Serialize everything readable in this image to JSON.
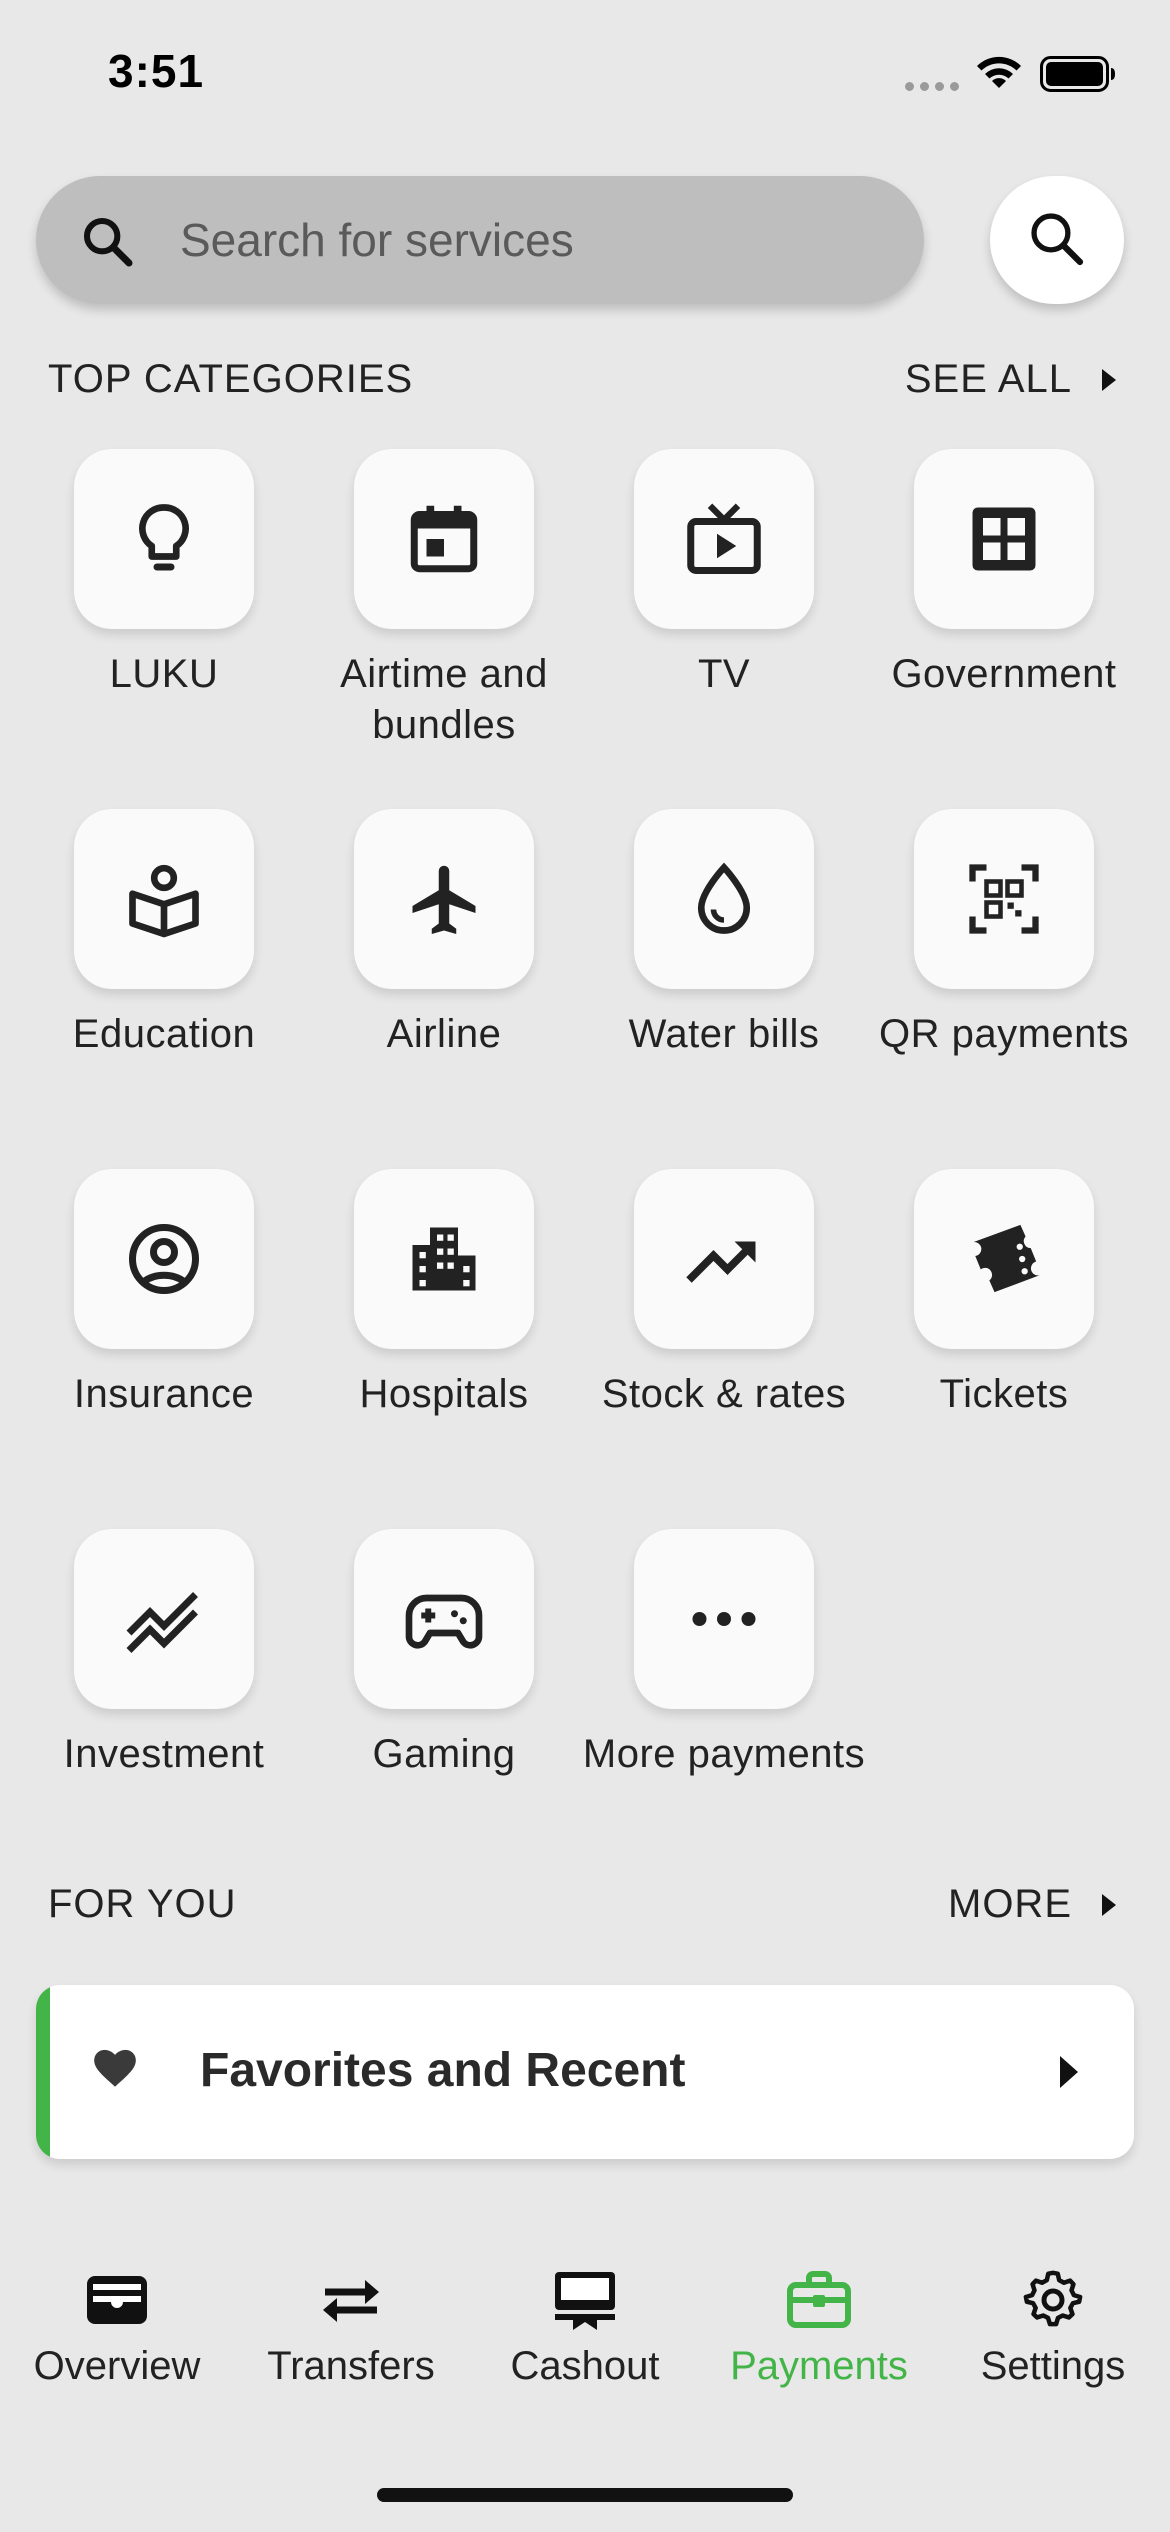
{
  "status_bar": {
    "time": "3:51"
  },
  "search": {
    "placeholder": "Search for services"
  },
  "top_categories": {
    "title": "TOP CATEGORIES",
    "link": "SEE ALL",
    "items": [
      {
        "label": "LUKU",
        "icon": "lightbulb-icon"
      },
      {
        "label": "Airtime and bundles",
        "icon": "calendar-icon"
      },
      {
        "label": "TV",
        "icon": "tv-icon"
      },
      {
        "label": "Government",
        "icon": "grid-icon"
      },
      {
        "label": "Education",
        "icon": "book-reader-icon"
      },
      {
        "label": "Airline",
        "icon": "airplane-icon"
      },
      {
        "label": "Water bills",
        "icon": "water-drop-icon"
      },
      {
        "label": "QR payments",
        "icon": "qr-code-icon"
      },
      {
        "label": "Insurance",
        "icon": "account-circle-icon"
      },
      {
        "label": "Hospitals",
        "icon": "building-icon"
      },
      {
        "label": "Stock & rates",
        "icon": "trending-up-icon"
      },
      {
        "label": "Tickets",
        "icon": "ticket-icon"
      },
      {
        "label": "Investment",
        "icon": "stacked-line-icon"
      },
      {
        "label": "Gaming",
        "icon": "gamepad-icon"
      },
      {
        "label": "More payments",
        "icon": "more-dots-icon"
      }
    ]
  },
  "for_you": {
    "title": "FOR YOU",
    "link": "MORE",
    "card": {
      "label": "Favorites and Recent",
      "icon": "heart-icon",
      "accent_color": "#43b447"
    }
  },
  "bottom_nav": {
    "active_color": "#43b447",
    "items": [
      {
        "label": "Overview",
        "icon": "wallet-icon"
      },
      {
        "label": "Transfers",
        "icon": "swap-arrows-icon"
      },
      {
        "label": "Cashout",
        "icon": "atm-icon"
      },
      {
        "label": "Payments",
        "icon": "briefcase-icon",
        "active": true
      },
      {
        "label": "Settings",
        "icon": "gear-icon"
      }
    ]
  }
}
